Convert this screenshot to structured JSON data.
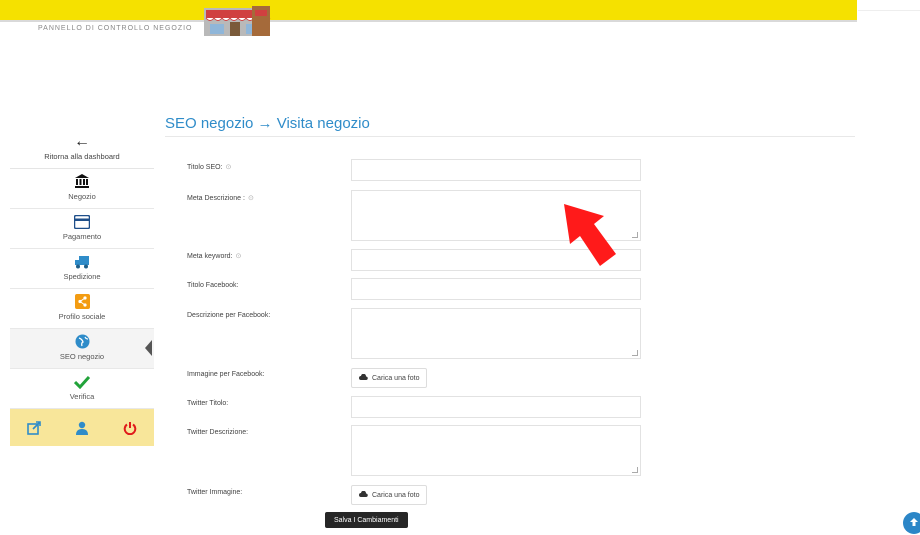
{
  "header": {
    "panel_title": "PANNELLO DI CONTROLLO NEGOZIO",
    "logo_icon": "shop-storefront-icon"
  },
  "page": {
    "title": "SEO negozio → Visita negozio"
  },
  "sidebar": {
    "back_label": "Ritorna alla dashboard",
    "items": [
      {
        "label": "Negozio",
        "icon": "bank-icon"
      },
      {
        "label": "Pagamento",
        "icon": "credit-card-icon"
      },
      {
        "label": "Spedizione",
        "icon": "truck-icon"
      },
      {
        "label": "Profilo sociale",
        "icon": "share-icon"
      },
      {
        "label": "SEO negozio",
        "icon": "globe-icon"
      },
      {
        "label": "Verifica",
        "icon": "checkmark-icon"
      }
    ],
    "active_item": "SEO negozio",
    "footer_icons": [
      "external-link-icon",
      "user-icon",
      "power-icon"
    ]
  },
  "form": {
    "fields": [
      {
        "label": "Titolo SEO:",
        "help": "⊙",
        "type": "text",
        "value": ""
      },
      {
        "label": "Meta Descrizione :",
        "help": "⊙",
        "type": "textarea",
        "value": ""
      },
      {
        "label": "Meta keyword:",
        "help": "⊙",
        "type": "text",
        "value": ""
      },
      {
        "label": "Titolo Facebook:",
        "help": "",
        "type": "text",
        "value": ""
      },
      {
        "label": "Descrizione per Facebook:",
        "help": "",
        "type": "textarea",
        "value": ""
      },
      {
        "label": "Immagine per Facebook:",
        "help": "",
        "type": "upload",
        "value": ""
      },
      {
        "label": "Twitter Titolo:",
        "help": "",
        "type": "text",
        "value": ""
      },
      {
        "label": "Twitter Descrizione:",
        "help": "",
        "type": "textarea",
        "value": ""
      },
      {
        "label": "Twitter Immagine:",
        "help": "",
        "type": "upload",
        "value": ""
      }
    ],
    "upload_label": "Carica una foto",
    "save_label": "Salva I Cambiamenti"
  },
  "colors": {
    "topbar": "#f5e100",
    "title_blue": "#2f8cc9",
    "annotation_arrow": "#ff1a1a"
  }
}
